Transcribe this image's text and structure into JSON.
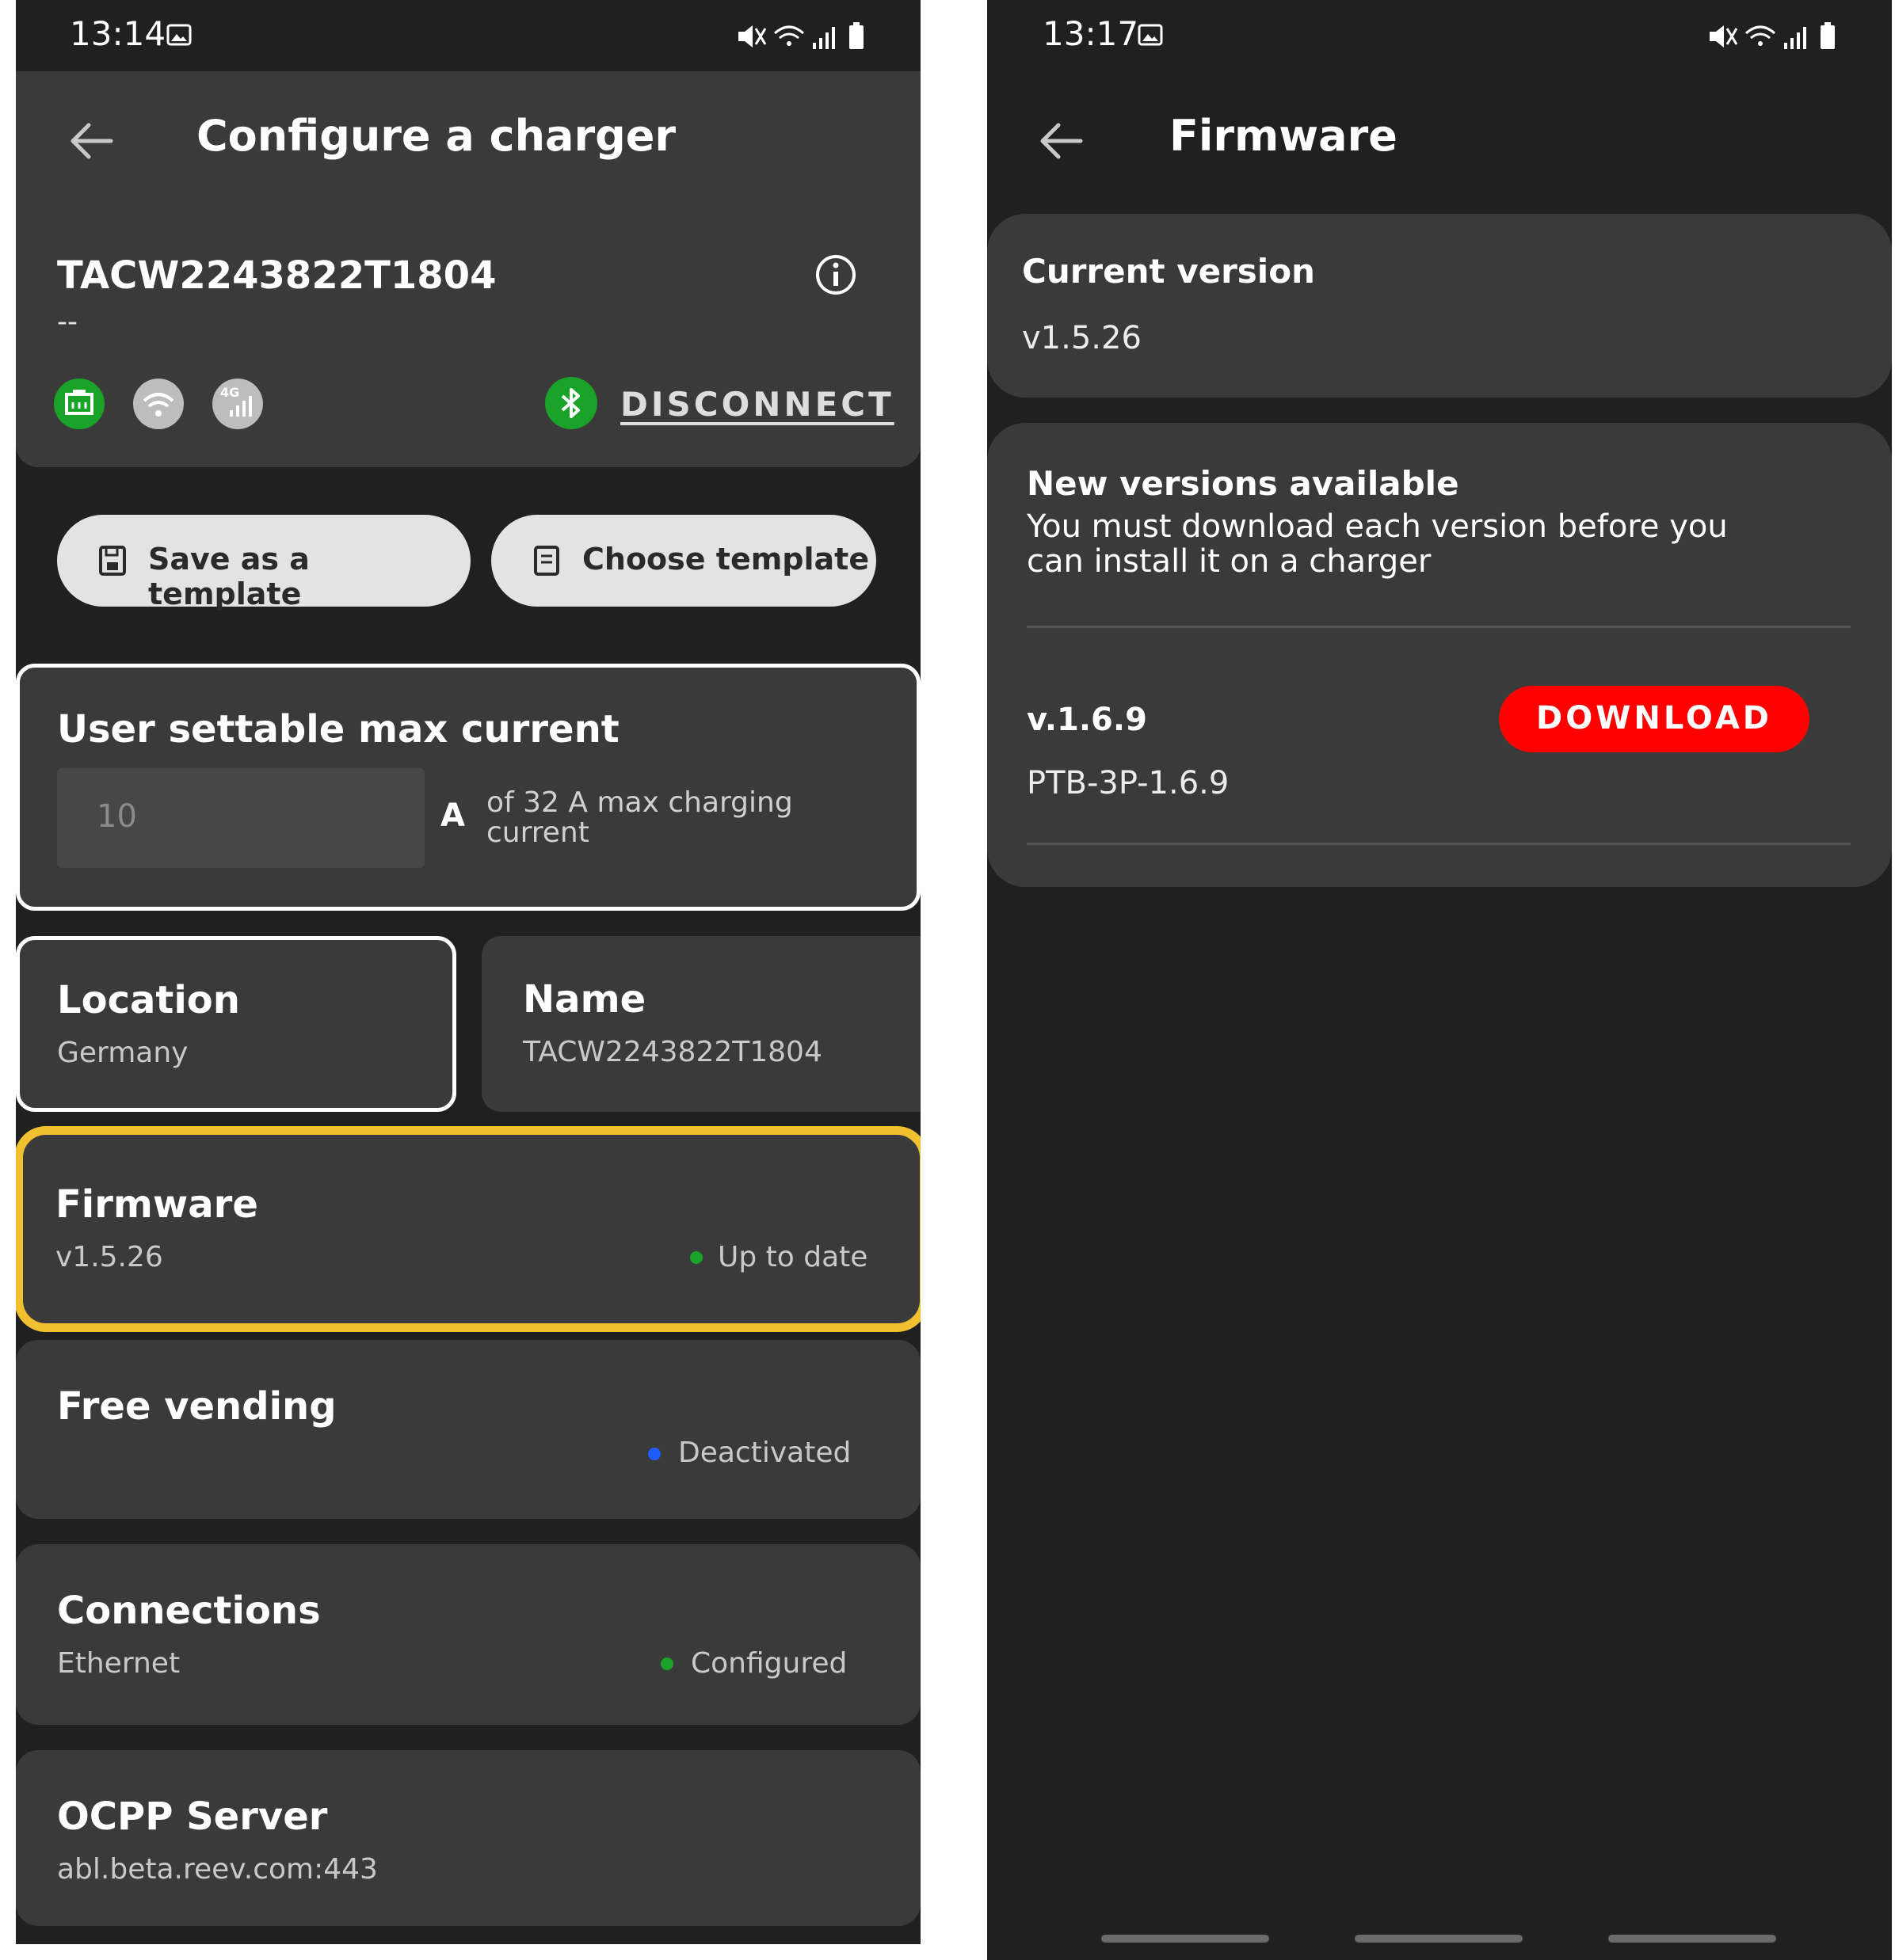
{
  "colors": {
    "screen_bg": "#202020",
    "card_bg": "#3a3a3a",
    "highlight": "#f0c030",
    "green": "#1aa329",
    "blue": "#1f5cff",
    "download_red": "#ff0000"
  },
  "left": {
    "status": {
      "time": "13:14"
    },
    "app_bar": {
      "title": "Configure a charger",
      "back_icon": "arrow-back-icon"
    },
    "charger": {
      "id": "TACW2243822T1804",
      "subtitle": "--",
      "info_icon": "info-icon",
      "connectivity": [
        {
          "icon": "ethernet-icon",
          "state": "active",
          "color": "#1aa329"
        },
        {
          "icon": "wifi-icon",
          "state": "inactive",
          "color": "#bdbdbd"
        },
        {
          "icon": "cellular-4g-icon",
          "label": "4G",
          "state": "inactive",
          "color": "#bdbdbd"
        }
      ],
      "bluetooth_icon": "bluetooth-icon",
      "disconnect_label": "DISCONNECT"
    },
    "buttons": {
      "save_template": "Save as a template",
      "choose_template": "Choose template"
    },
    "max_current": {
      "title": "User settable max current",
      "value": "10",
      "unit": "A",
      "hint_line1": "of 32 A max charging",
      "hint_line2": "current"
    },
    "location": {
      "title": "Location",
      "value": "Germany"
    },
    "name": {
      "title": "Name",
      "value": "TACW2243822T1804"
    },
    "firmware": {
      "title": "Firmware",
      "version": "v1.5.26",
      "status": "Up to date",
      "highlighted": true
    },
    "free_vending": {
      "title": "Free vending",
      "status": "Deactivated"
    },
    "connections": {
      "title": "Connections",
      "value": "Ethernet",
      "status": "Configured"
    },
    "ocpp": {
      "title": "OCPP Server",
      "value": "abl.beta.reev.com:443"
    }
  },
  "right": {
    "status": {
      "time": "13:17"
    },
    "app_bar": {
      "title": "Firmware",
      "back_icon": "arrow-back-icon"
    },
    "current_version": {
      "title": "Current version",
      "value": "v1.5.26"
    },
    "new_versions": {
      "title": "New versions available",
      "description_line1": "You must download each version before you",
      "description_line2": "can install it on a charger",
      "items": [
        {
          "version": "v.1.6.9",
          "package": "PTB-3P-1.6.9",
          "action": "DOWNLOAD"
        }
      ]
    }
  }
}
